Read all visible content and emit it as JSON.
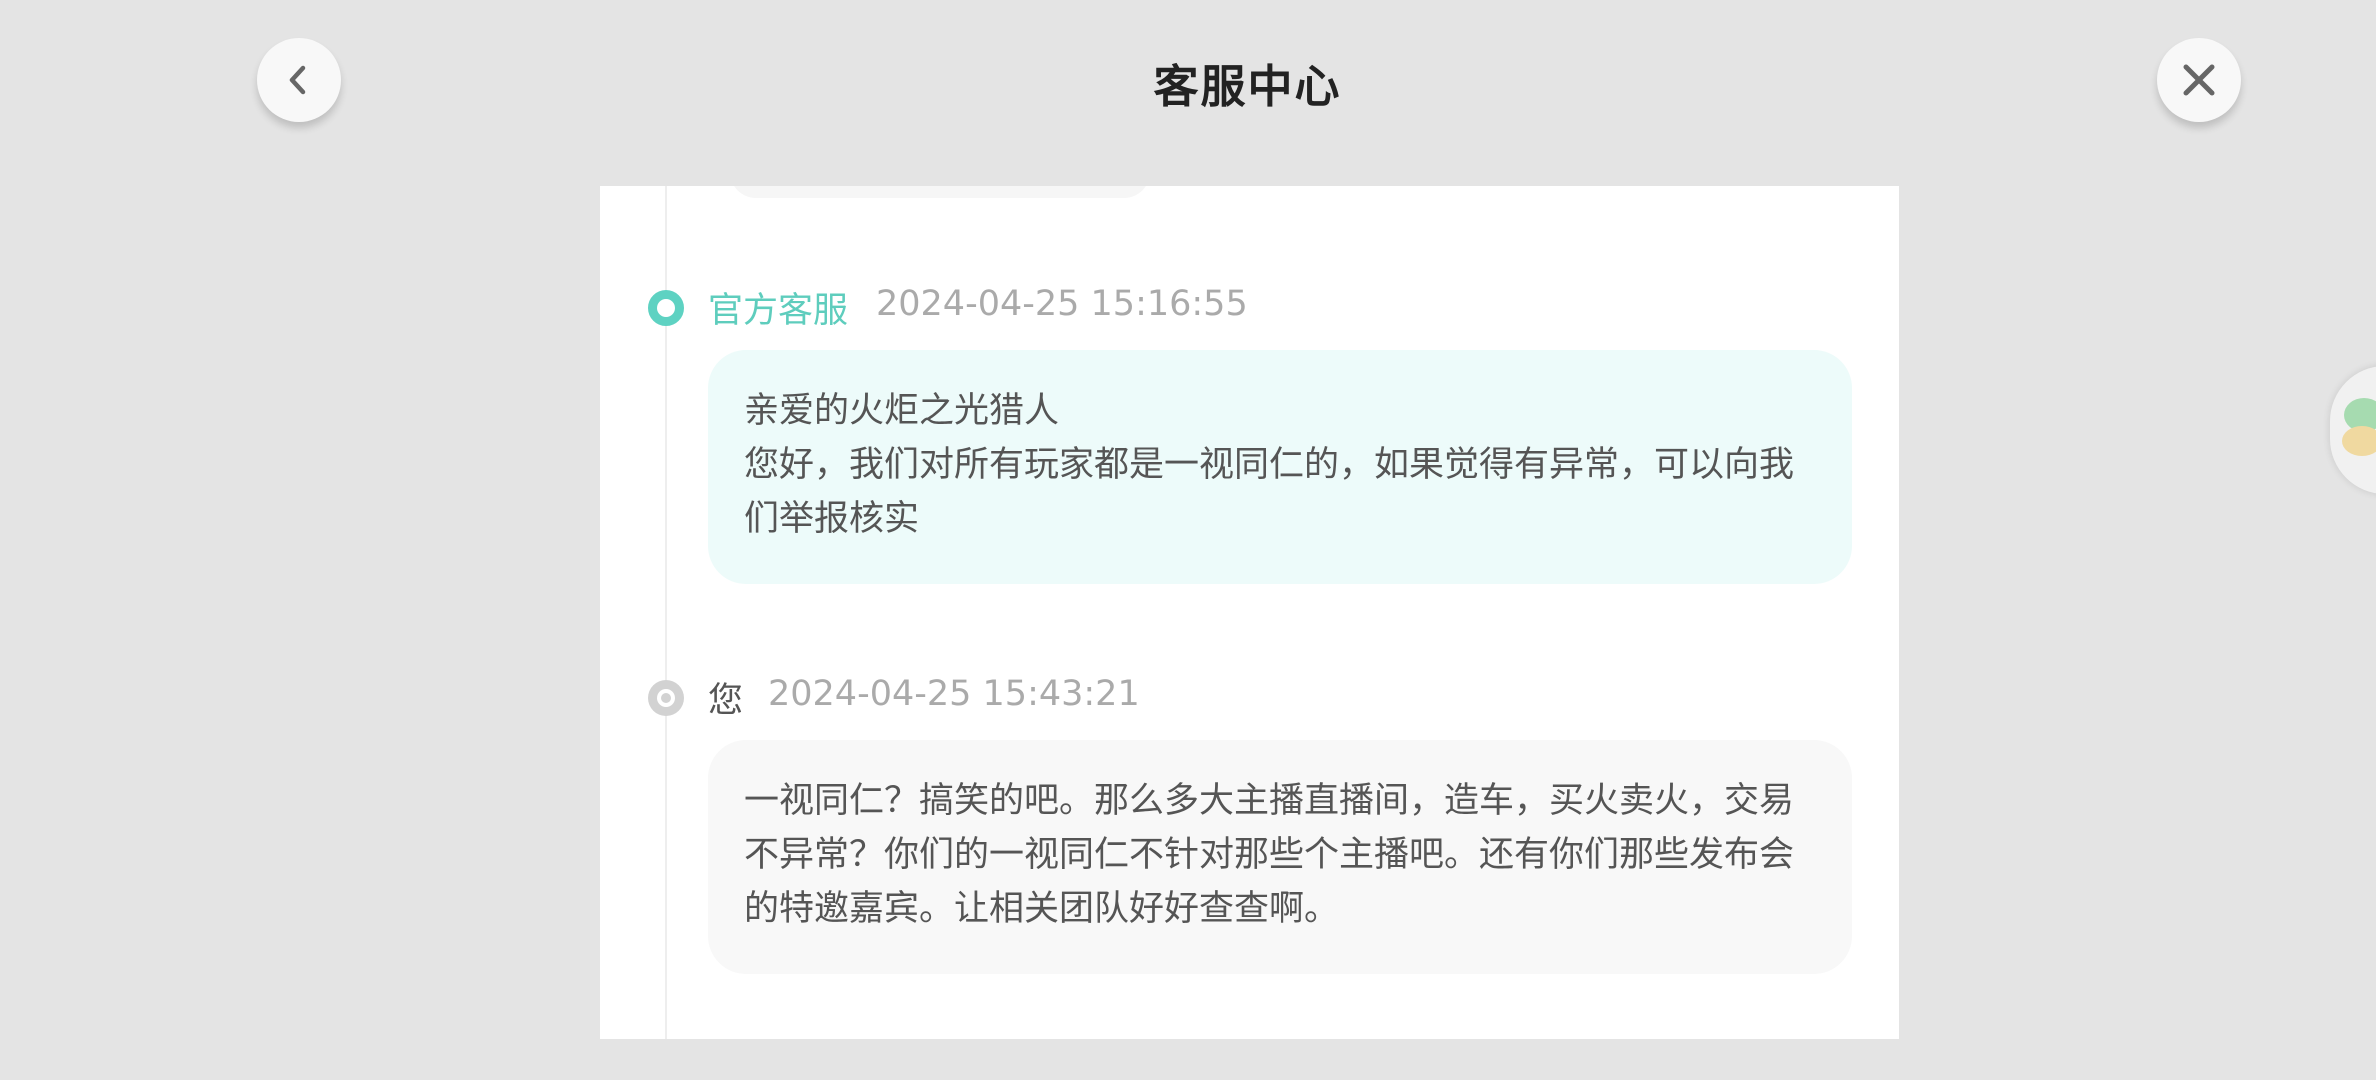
{
  "header": {
    "title": "客服中心",
    "back_icon": "chevron-left-icon",
    "close_icon": "close-icon"
  },
  "messages": [
    {
      "role": "agent",
      "sender": "官方客服",
      "time": "2024-04-25 15:16:55",
      "lines": [
        "亲爱的火炬之光猎人",
        "您好，我们对所有玩家都是一视同仁的，如果觉得有异常，可以向我们举报核实"
      ]
    },
    {
      "role": "user",
      "sender": "您",
      "time": "2024-04-25 15:43:21",
      "lines": [
        "一视同仁？搞笑的吧。那么多大主播直播间，造车，买火卖火，交易不异常？你们的一视同仁不针对那些个主播吧。还有你们那些发布会的特邀嘉宾。让相关团队好好查查啊。"
      ]
    }
  ],
  "colors": {
    "background": "#e4e4e4",
    "accent": "#5ecdbd",
    "agent_bubble": "#edfbfa",
    "user_bubble": "#f8f8f8"
  }
}
